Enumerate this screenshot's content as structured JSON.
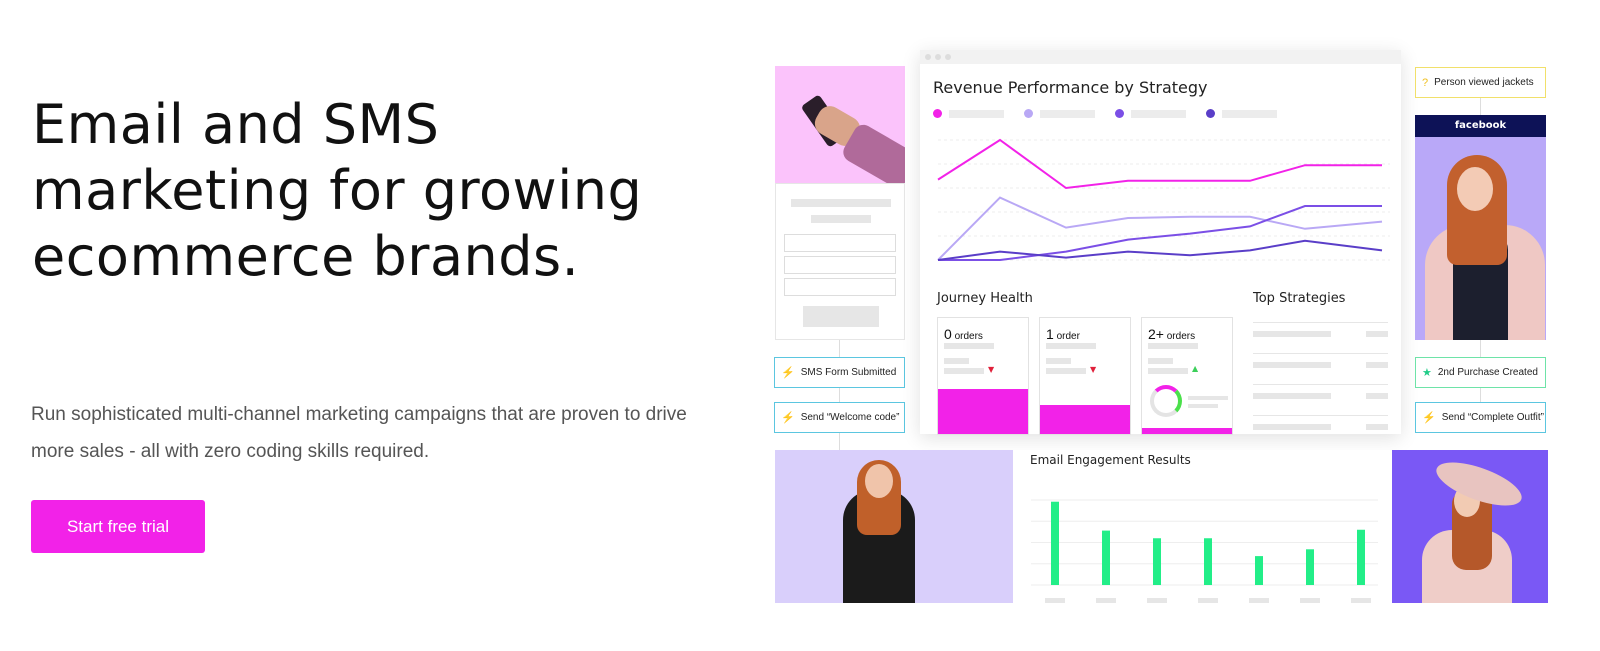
{
  "hero": {
    "heading": "Email and SMS marketing for growing ecommerce brands.",
    "subheading": "Run sophisticated multi-channel marketing campaigns that are proven to drive more sales - all with zero coding skills required.",
    "cta_label": "Start free trial"
  },
  "colors": {
    "accent": "#f222e8",
    "green": "#22ee88",
    "lavender": "#b9a8f5",
    "violet": "#7b4fe6",
    "indigo": "#5a3ec8"
  },
  "flow_left": {
    "nodes": [
      {
        "icon": "lightning-icon",
        "label": "SMS Form Submitted"
      },
      {
        "icon": "lightning-icon",
        "label": "Send “Welcome code”"
      }
    ]
  },
  "flow_right": {
    "nodes": [
      {
        "icon": "question-icon",
        "label": "Person viewed jackets"
      },
      {
        "icon": "star-icon",
        "label": "2nd Purchase Created"
      },
      {
        "icon": "lightning-icon",
        "label": "Send “Complete Outfit”"
      }
    ],
    "ad_platform": "facebook"
  },
  "dashboard": {
    "revenue_title": "Revenue Performance by Strategy",
    "journey_title": "Journey Health",
    "journey_cards": [
      {
        "count": "0",
        "unit": "orders",
        "trend": "down",
        "fill": 0.38
      },
      {
        "count": "1",
        "unit": "order",
        "trend": "down",
        "fill": 0.25
      },
      {
        "count": "2+",
        "unit": "orders",
        "trend": "up",
        "fill": 0.05
      }
    ],
    "top_strategies_title": "Top Strategies",
    "engagement_title": "Email Engagement Results"
  },
  "chart_data": [
    {
      "type": "line",
      "title": "Revenue Performance by Strategy",
      "grid": true,
      "ylim": [
        0,
        100
      ],
      "series": [
        {
          "color": "#f222e8",
          "values": [
            67,
            100,
            60,
            66,
            66,
            66,
            79,
            79
          ]
        },
        {
          "color": "#b9a8f5",
          "values": [
            0,
            52,
            27,
            35,
            36,
            36,
            26,
            32
          ]
        },
        {
          "color": "#7b4fe6",
          "values": [
            0,
            0,
            7,
            17,
            22,
            28,
            45,
            45
          ]
        },
        {
          "color": "#5a3ec8",
          "values": [
            0,
            7,
            2,
            7,
            4,
            8,
            16,
            8
          ]
        }
      ]
    },
    {
      "type": "bar",
      "title": "Email Engagement Results",
      "grid": true,
      "ylim": [
        0,
        100
      ],
      "values": [
        98,
        64,
        55,
        55,
        34,
        42,
        65
      ],
      "color": "#22ee88"
    }
  ]
}
